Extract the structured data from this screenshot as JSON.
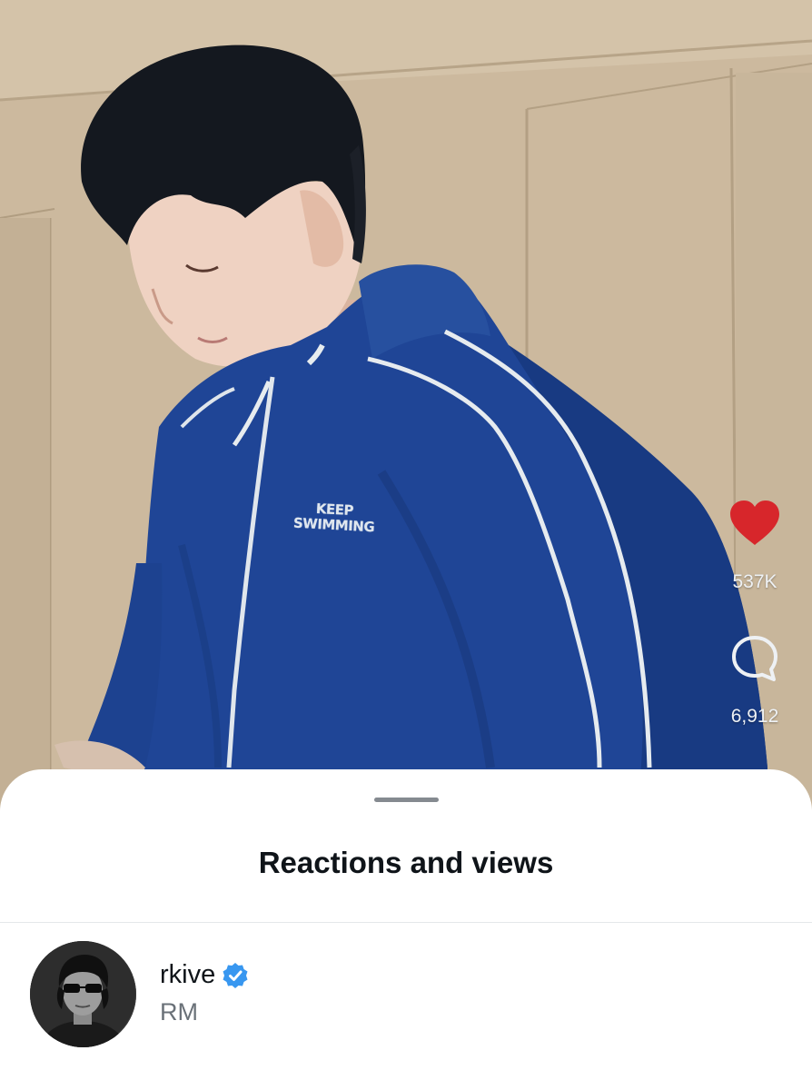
{
  "video": {
    "jacket_print_line1": "KEEP",
    "jacket_print_line2": "SWIMMING"
  },
  "actions": {
    "like": {
      "icon": "heart-icon",
      "color": "#d7262b",
      "count": "537K"
    },
    "comment": {
      "icon": "speech-bubble-icon",
      "count": "6,912"
    }
  },
  "sheet": {
    "title": "Reactions and views"
  },
  "reactions": [
    {
      "username": "rkive",
      "verified": true,
      "display_name": "RM"
    }
  ],
  "colors": {
    "verified_badge": "#3897f0",
    "like_heart": "#d7262b"
  }
}
